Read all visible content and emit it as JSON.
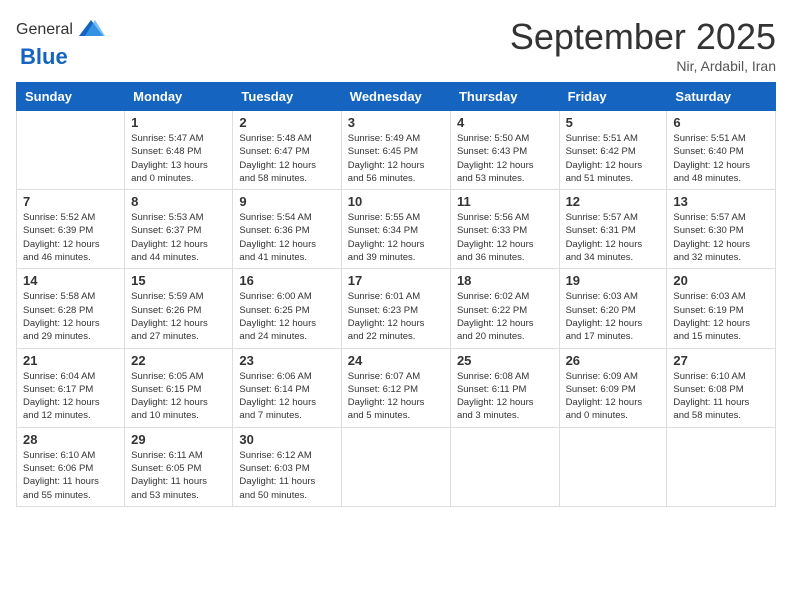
{
  "logo": {
    "general": "General",
    "blue": "Blue"
  },
  "title": "September 2025",
  "location": "Nir, Ardabil, Iran",
  "days_of_week": [
    "Sunday",
    "Monday",
    "Tuesday",
    "Wednesday",
    "Thursday",
    "Friday",
    "Saturday"
  ],
  "weeks": [
    [
      {
        "day": "",
        "info": ""
      },
      {
        "day": "1",
        "info": "Sunrise: 5:47 AM\nSunset: 6:48 PM\nDaylight: 13 hours\nand 0 minutes."
      },
      {
        "day": "2",
        "info": "Sunrise: 5:48 AM\nSunset: 6:47 PM\nDaylight: 12 hours\nand 58 minutes."
      },
      {
        "day": "3",
        "info": "Sunrise: 5:49 AM\nSunset: 6:45 PM\nDaylight: 12 hours\nand 56 minutes."
      },
      {
        "day": "4",
        "info": "Sunrise: 5:50 AM\nSunset: 6:43 PM\nDaylight: 12 hours\nand 53 minutes."
      },
      {
        "day": "5",
        "info": "Sunrise: 5:51 AM\nSunset: 6:42 PM\nDaylight: 12 hours\nand 51 minutes."
      },
      {
        "day": "6",
        "info": "Sunrise: 5:51 AM\nSunset: 6:40 PM\nDaylight: 12 hours\nand 48 minutes."
      }
    ],
    [
      {
        "day": "7",
        "info": "Sunrise: 5:52 AM\nSunset: 6:39 PM\nDaylight: 12 hours\nand 46 minutes."
      },
      {
        "day": "8",
        "info": "Sunrise: 5:53 AM\nSunset: 6:37 PM\nDaylight: 12 hours\nand 44 minutes."
      },
      {
        "day": "9",
        "info": "Sunrise: 5:54 AM\nSunset: 6:36 PM\nDaylight: 12 hours\nand 41 minutes."
      },
      {
        "day": "10",
        "info": "Sunrise: 5:55 AM\nSunset: 6:34 PM\nDaylight: 12 hours\nand 39 minutes."
      },
      {
        "day": "11",
        "info": "Sunrise: 5:56 AM\nSunset: 6:33 PM\nDaylight: 12 hours\nand 36 minutes."
      },
      {
        "day": "12",
        "info": "Sunrise: 5:57 AM\nSunset: 6:31 PM\nDaylight: 12 hours\nand 34 minutes."
      },
      {
        "day": "13",
        "info": "Sunrise: 5:57 AM\nSunset: 6:30 PM\nDaylight: 12 hours\nand 32 minutes."
      }
    ],
    [
      {
        "day": "14",
        "info": "Sunrise: 5:58 AM\nSunset: 6:28 PM\nDaylight: 12 hours\nand 29 minutes."
      },
      {
        "day": "15",
        "info": "Sunrise: 5:59 AM\nSunset: 6:26 PM\nDaylight: 12 hours\nand 27 minutes."
      },
      {
        "day": "16",
        "info": "Sunrise: 6:00 AM\nSunset: 6:25 PM\nDaylight: 12 hours\nand 24 minutes."
      },
      {
        "day": "17",
        "info": "Sunrise: 6:01 AM\nSunset: 6:23 PM\nDaylight: 12 hours\nand 22 minutes."
      },
      {
        "day": "18",
        "info": "Sunrise: 6:02 AM\nSunset: 6:22 PM\nDaylight: 12 hours\nand 20 minutes."
      },
      {
        "day": "19",
        "info": "Sunrise: 6:03 AM\nSunset: 6:20 PM\nDaylight: 12 hours\nand 17 minutes."
      },
      {
        "day": "20",
        "info": "Sunrise: 6:03 AM\nSunset: 6:19 PM\nDaylight: 12 hours\nand 15 minutes."
      }
    ],
    [
      {
        "day": "21",
        "info": "Sunrise: 6:04 AM\nSunset: 6:17 PM\nDaylight: 12 hours\nand 12 minutes."
      },
      {
        "day": "22",
        "info": "Sunrise: 6:05 AM\nSunset: 6:15 PM\nDaylight: 12 hours\nand 10 minutes."
      },
      {
        "day": "23",
        "info": "Sunrise: 6:06 AM\nSunset: 6:14 PM\nDaylight: 12 hours\nand 7 minutes."
      },
      {
        "day": "24",
        "info": "Sunrise: 6:07 AM\nSunset: 6:12 PM\nDaylight: 12 hours\nand 5 minutes."
      },
      {
        "day": "25",
        "info": "Sunrise: 6:08 AM\nSunset: 6:11 PM\nDaylight: 12 hours\nand 3 minutes."
      },
      {
        "day": "26",
        "info": "Sunrise: 6:09 AM\nSunset: 6:09 PM\nDaylight: 12 hours\nand 0 minutes."
      },
      {
        "day": "27",
        "info": "Sunrise: 6:10 AM\nSunset: 6:08 PM\nDaylight: 11 hours\nand 58 minutes."
      }
    ],
    [
      {
        "day": "28",
        "info": "Sunrise: 6:10 AM\nSunset: 6:06 PM\nDaylight: 11 hours\nand 55 minutes."
      },
      {
        "day": "29",
        "info": "Sunrise: 6:11 AM\nSunset: 6:05 PM\nDaylight: 11 hours\nand 53 minutes."
      },
      {
        "day": "30",
        "info": "Sunrise: 6:12 AM\nSunset: 6:03 PM\nDaylight: 11 hours\nand 50 minutes."
      },
      {
        "day": "",
        "info": ""
      },
      {
        "day": "",
        "info": ""
      },
      {
        "day": "",
        "info": ""
      },
      {
        "day": "",
        "info": ""
      }
    ]
  ]
}
